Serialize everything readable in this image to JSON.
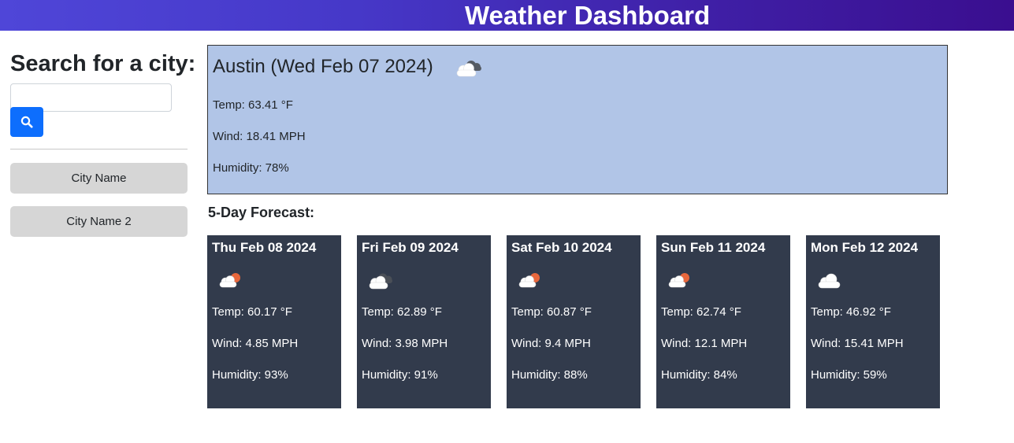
{
  "header": {
    "title": "Weather Dashboard"
  },
  "sidebar": {
    "title": "Search for a city:",
    "search": {
      "placeholder": "",
      "value": ""
    },
    "search_button_icon": "search-icon",
    "history": [
      {
        "label": "City Name"
      },
      {
        "label": "City Name 2"
      }
    ]
  },
  "current": {
    "title": "Austin (Wed Feb 07 2024)",
    "icon": "broken-clouds-icon",
    "temp": "Temp: 63.41 °F",
    "wind": "Wind: 18.41 MPH",
    "humidity": "Humidity: 78%"
  },
  "forecast": {
    "heading": "5-Day Forecast:",
    "days": [
      {
        "date": "Thu Feb 08 2024",
        "icon": "partly-cloudy-day-icon",
        "temp": "Temp: 60.17 °F",
        "wind": "Wind: 4.85 MPH",
        "humidity": "Humidity: 93%"
      },
      {
        "date": "Fri Feb 09 2024",
        "icon": "broken-clouds-icon",
        "temp": "Temp: 62.89 °F",
        "wind": "Wind: 3.98 MPH",
        "humidity": "Humidity: 91%"
      },
      {
        "date": "Sat Feb 10 2024",
        "icon": "partly-cloudy-day-icon",
        "temp": "Temp: 60.87 °F",
        "wind": "Wind: 9.4 MPH",
        "humidity": "Humidity: 88%"
      },
      {
        "date": "Sun Feb 11 2024",
        "icon": "partly-cloudy-day-icon",
        "temp": "Temp: 62.74 °F",
        "wind": "Wind: 12.1 MPH",
        "humidity": "Humidity: 84%"
      },
      {
        "date": "Mon Feb 12 2024",
        "icon": "cloud-icon",
        "temp": "Temp: 46.92 °F",
        "wind": "Wind: 15.41 MPH",
        "humidity": "Humidity: 59%"
      }
    ]
  },
  "colors": {
    "header_start": "#4f46d8",
    "header_end": "#3a0e8f",
    "current_bg": "#b1c5e7",
    "card_bg": "#323b4c",
    "search_button": "#0d6efd",
    "history_button": "#d6d6d6"
  }
}
